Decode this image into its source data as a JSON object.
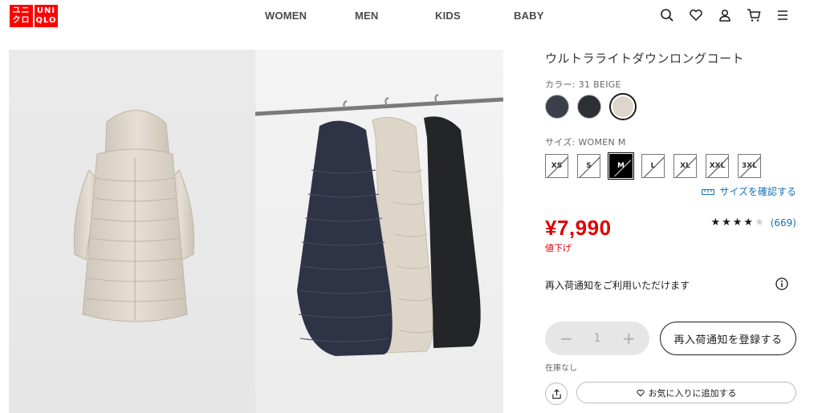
{
  "header": {
    "logo_top": "ユニ",
    "logo_mid": "クロ",
    "logo_top_en": "UNI",
    "logo_mid_en": "QLO",
    "nav": [
      "WOMEN",
      "MEN",
      "KIDS",
      "BABY"
    ],
    "icons": [
      "search-icon",
      "heart-icon",
      "user-icon",
      "cart-icon",
      "menu-icon"
    ]
  },
  "product": {
    "title": "ウルトラライトダウンロングコート",
    "color_label": "カラー: 31 BEIGE",
    "swatches": [
      {
        "color": "#3a3f4a",
        "selected": false
      },
      {
        "color": "#2c2f33",
        "selected": false
      },
      {
        "color": "#ddd6cb",
        "selected": true
      }
    ],
    "size_label": "サイズ: WOMEN M",
    "sizes": [
      "XS",
      "S",
      "M",
      "L",
      "XL",
      "XXL",
      "3XL"
    ],
    "selected_size": "M",
    "size_check": "サイズを確認する",
    "price": "¥7,990",
    "price_note": "値下げ",
    "rating": {
      "stars_filled": 4,
      "stars_total": 5,
      "count": "(669)"
    },
    "restock_text": "再入荷通知をご利用いただけます",
    "quantity": {
      "minus": "−",
      "value": "1",
      "plus": "+"
    },
    "notify_button": "再入荷通知を登録する",
    "stock_text": "在庫なし",
    "favorite_button": "お気に入りに追加する"
  },
  "colors": {
    "brand_red": "#ff0000",
    "price_red": "#e00000",
    "link_blue": "#1a6fb0"
  }
}
